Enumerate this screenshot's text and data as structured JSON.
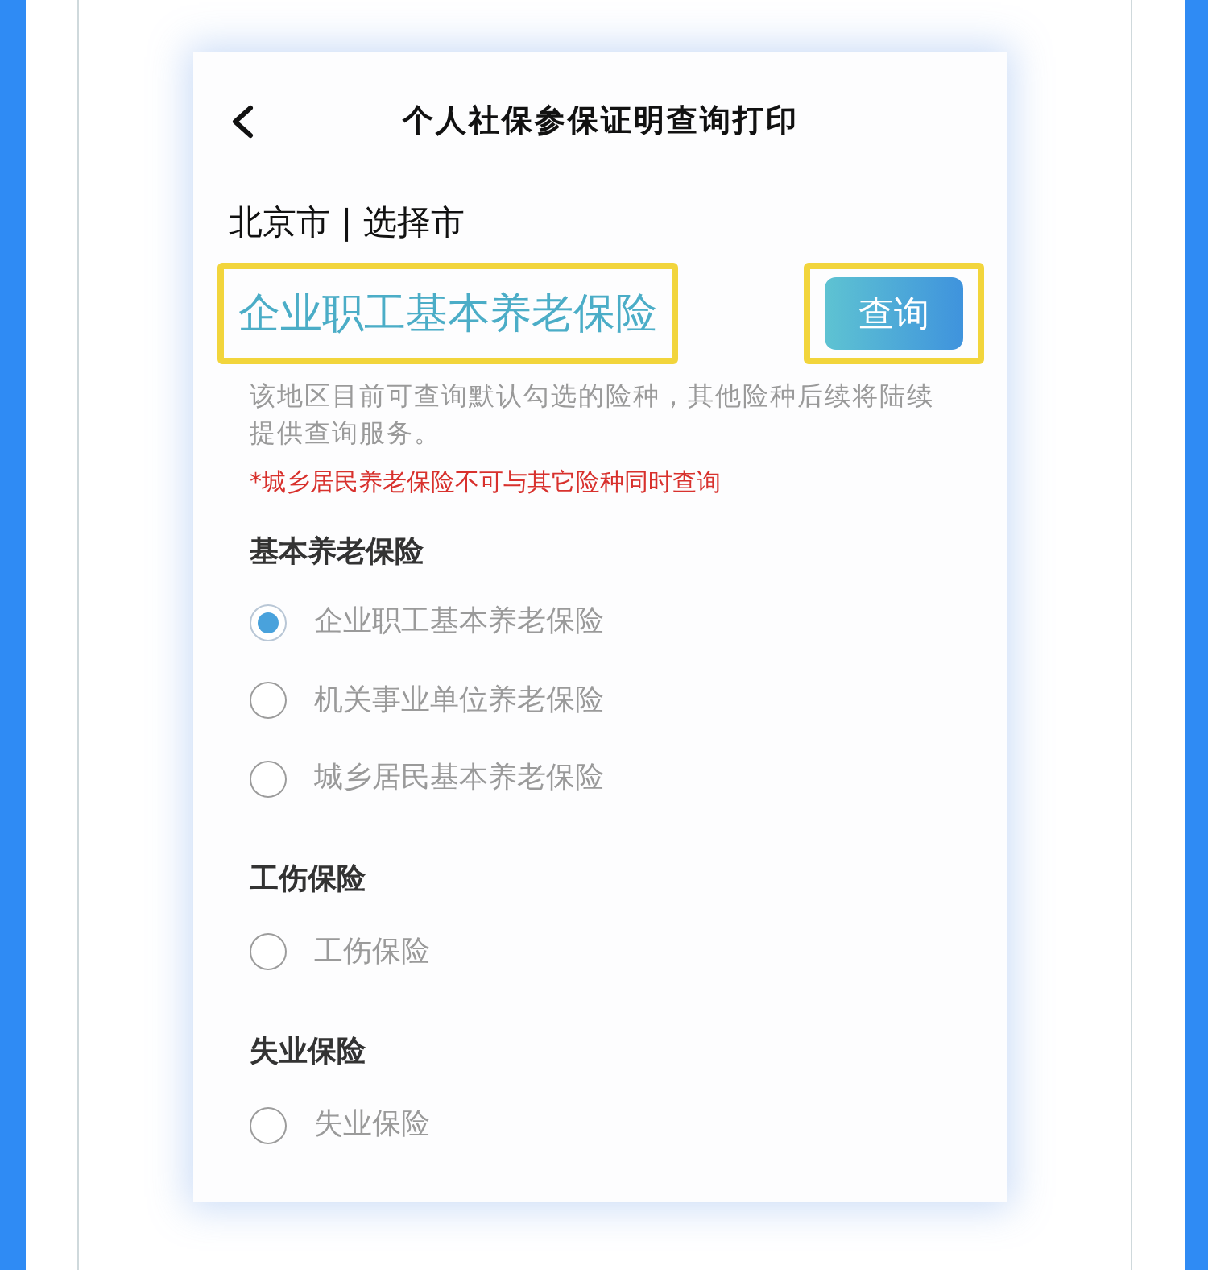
{
  "header": {
    "title": "个人社保参保证明查询打印"
  },
  "location": {
    "text": "北京市 | 选择市"
  },
  "selected_plan": {
    "label": "企业职工基本养老保险",
    "highlighted": true
  },
  "query_button": {
    "label": "查询",
    "highlighted": true
  },
  "notice": "该地区目前可查询默认勾选的险种，其他险种后续将陆续提供查询服务。",
  "warning": "*城乡居民养老保险不可与其它险种同时查询",
  "groups": [
    {
      "title": "基本养老保险",
      "options": [
        {
          "label": "企业职工基本养老保险",
          "selected": true
        },
        {
          "label": "机关事业单位养老保险",
          "selected": false
        },
        {
          "label": "城乡居民基本养老保险",
          "selected": false
        }
      ]
    },
    {
      "title": "工伤保险",
      "options": [
        {
          "label": "工伤保险",
          "selected": false
        }
      ]
    },
    {
      "title": "失业保险",
      "options": [
        {
          "label": "失业保险",
          "selected": false
        }
      ]
    }
  ]
}
